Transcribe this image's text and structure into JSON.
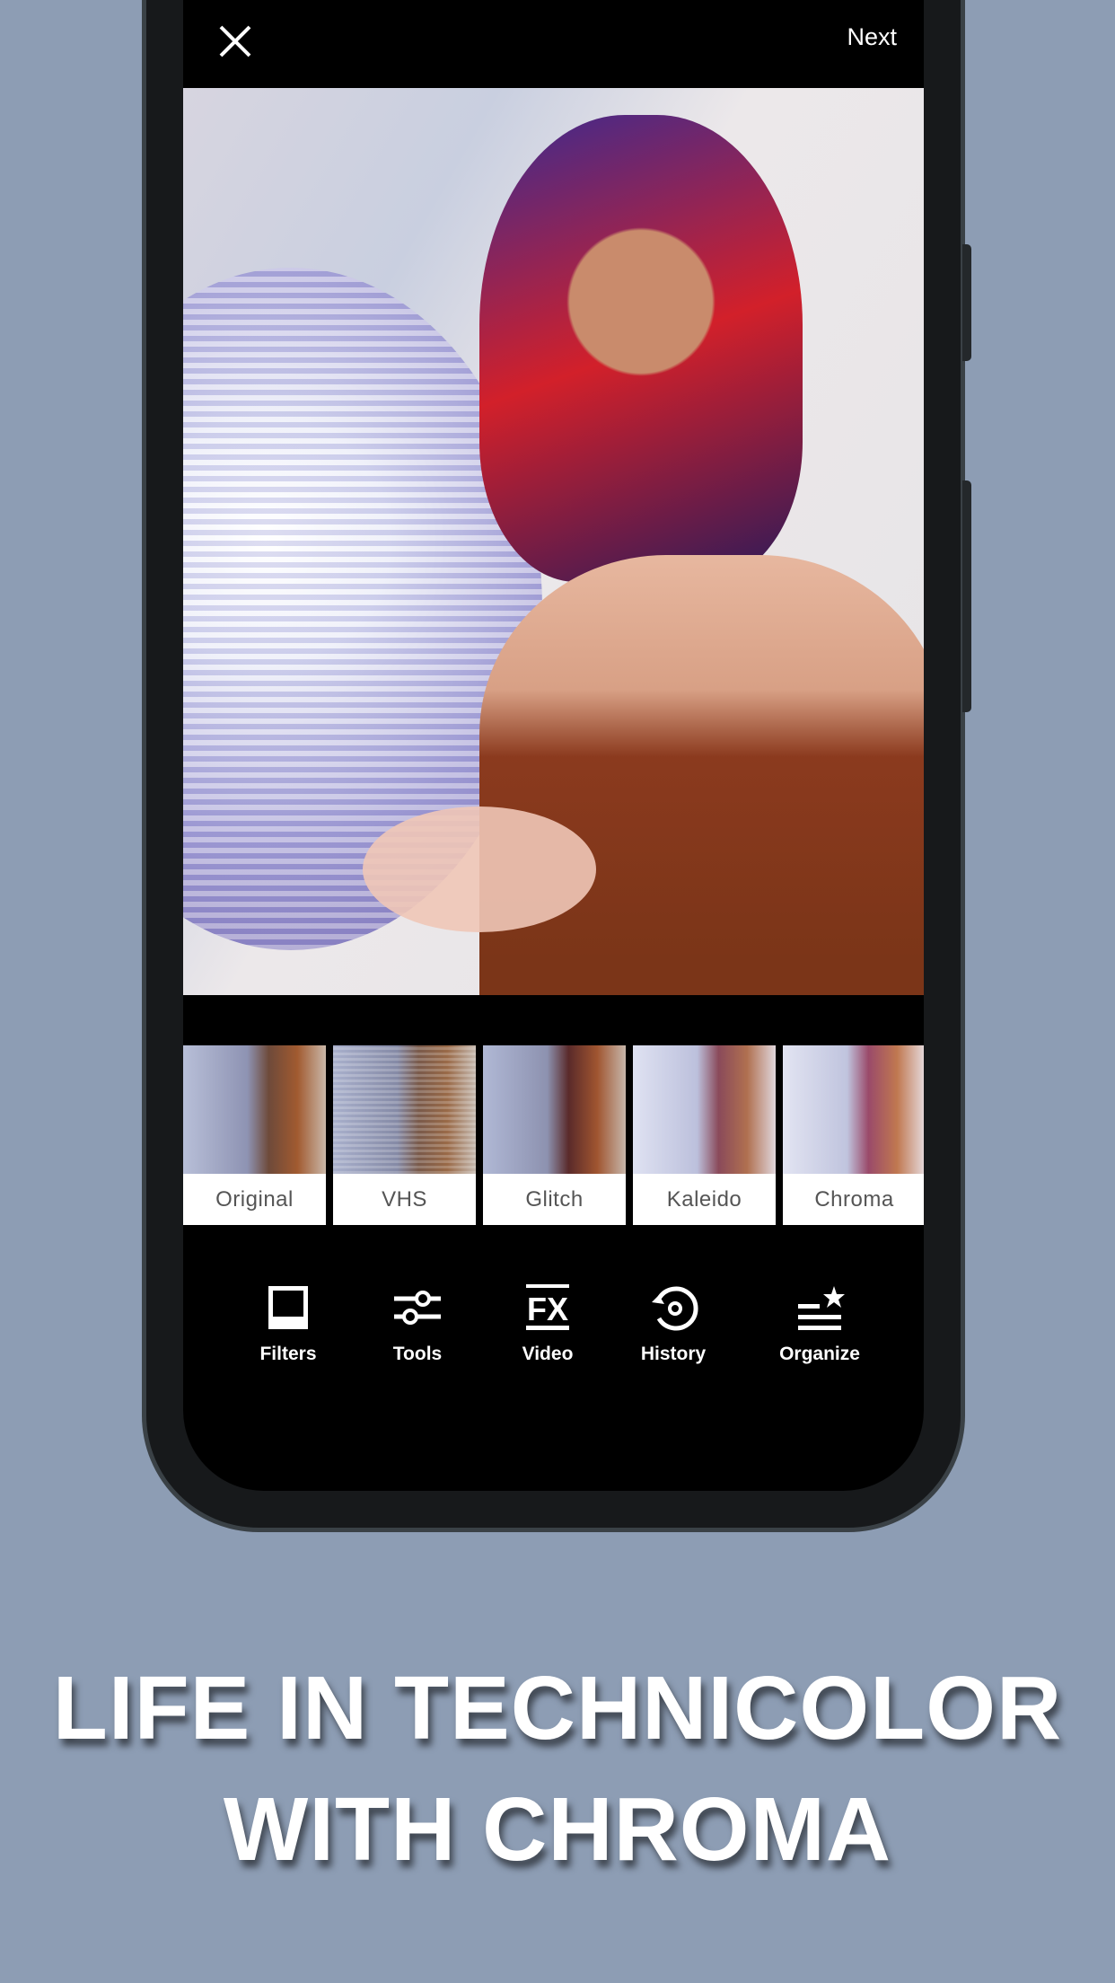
{
  "topbar": {
    "close_icon": "close-icon",
    "next_label": "Next"
  },
  "filters": [
    {
      "label": "Original"
    },
    {
      "label": "VHS"
    },
    {
      "label": "Glitch"
    },
    {
      "label": "Kaleido"
    },
    {
      "label": "Chroma"
    }
  ],
  "toolbar": [
    {
      "label": "Filters",
      "icon": "filters-icon"
    },
    {
      "label": "Tools",
      "icon": "sliders-icon"
    },
    {
      "label": "Video",
      "icon": "fx-icon"
    },
    {
      "label": "History",
      "icon": "history-icon"
    },
    {
      "label": "Organize",
      "icon": "organize-star-icon"
    }
  ],
  "headline": {
    "line1": "LIFE IN TECHNICOLOR",
    "line2": "WITH CHROMA"
  },
  "colors": {
    "background": "#8d9db4",
    "screen": "#000000",
    "text": "#ffffff"
  }
}
